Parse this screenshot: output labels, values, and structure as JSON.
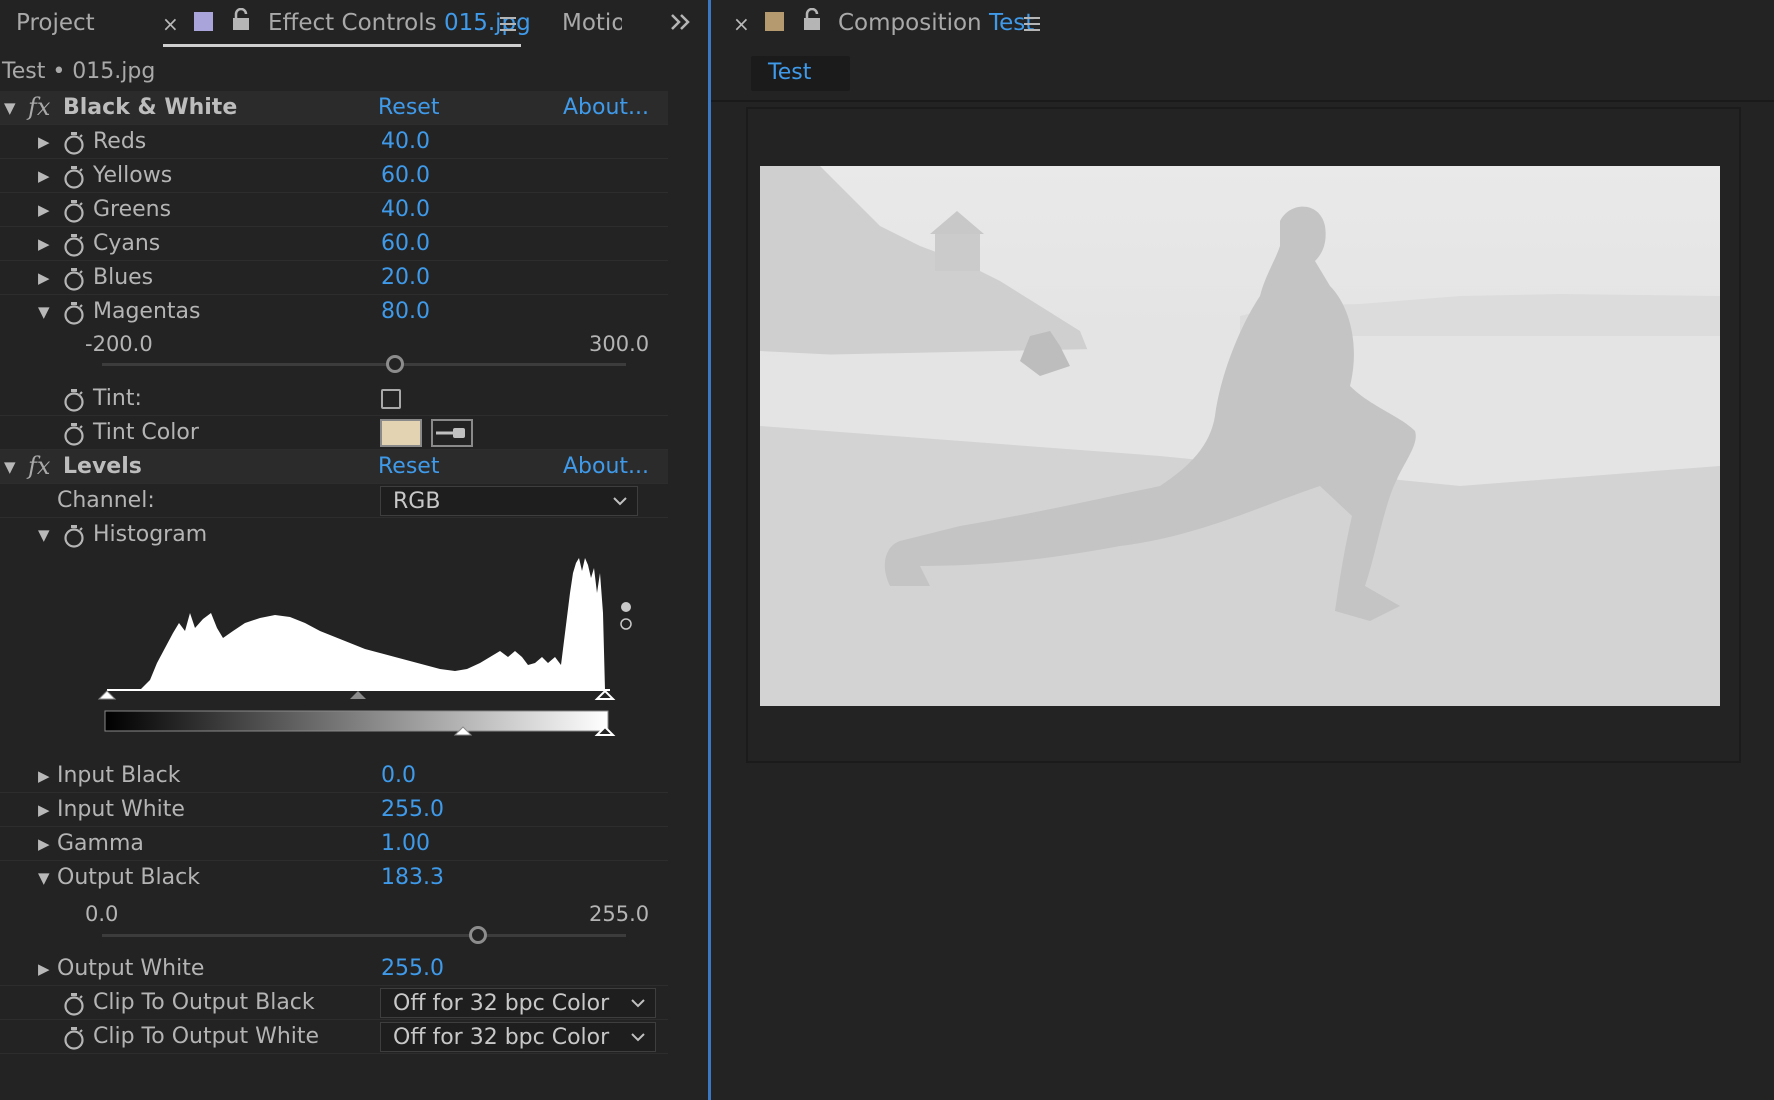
{
  "left_panel": {
    "tabs": {
      "project": "Project",
      "effect_controls_label": "Effect Controls",
      "effect_controls_file": "015.jpg",
      "motion": "Motio"
    },
    "layer_path": "Test • 015.jpg",
    "black_white": {
      "title": "Black & White",
      "reset": "Reset",
      "about": "About...",
      "params": [
        {
          "label": "Reds",
          "value": "40.0"
        },
        {
          "label": "Yellows",
          "value": "60.0"
        },
        {
          "label": "Greens",
          "value": "40.0"
        },
        {
          "label": "Cyans",
          "value": "60.0"
        },
        {
          "label": "Blues",
          "value": "20.0"
        },
        {
          "label": "Magentas",
          "value": "80.0"
        }
      ],
      "magentas_range": {
        "min": "-200.0",
        "max": "300.0"
      },
      "tint_label": "Tint:",
      "tint_color_label": "Tint Color",
      "tint_color_hex": "#e3d3b2"
    },
    "levels": {
      "title": "Levels",
      "reset": "Reset",
      "about": "About...",
      "channel_label": "Channel:",
      "channel_value": "RGB",
      "histogram_label": "Histogram",
      "params": [
        {
          "label": "Input Black",
          "value": "0.0"
        },
        {
          "label": "Input White",
          "value": "255.0"
        },
        {
          "label": "Gamma",
          "value": "1.00"
        },
        {
          "label": "Output Black",
          "value": "183.3"
        }
      ],
      "output_black_range": {
        "min": "0.0",
        "max": "255.0"
      },
      "output_white": {
        "label": "Output White",
        "value": "255.0"
      },
      "clip_black": {
        "label": "Clip To Output Black",
        "value": "Off for 32 bpc Color"
      },
      "clip_white": {
        "label": "Clip To Output White",
        "value": "Off for 32 bpc Color"
      }
    }
  },
  "right_panel": {
    "comp_label": "Composition",
    "comp_name": "Test",
    "viewer_tab": "Test"
  },
  "colors": {
    "accent": "#3f9aea",
    "panel_bg": "#232323",
    "active_panel_border": "#3a78c4"
  }
}
